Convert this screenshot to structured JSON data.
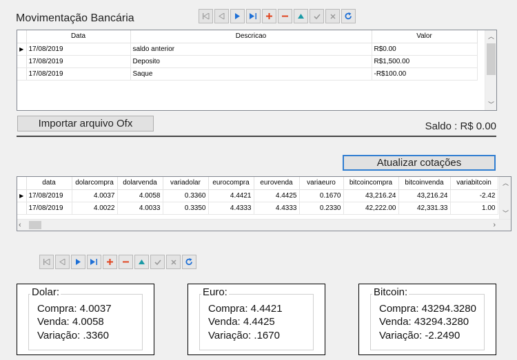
{
  "window": {
    "title": "Movimentação Bancária"
  },
  "mov_grid": {
    "columns": [
      "Data",
      "Descricao",
      "Valor"
    ],
    "rows": [
      {
        "data": "17/08/2019",
        "descricao": "saldo anterior",
        "valor": "R$0.00"
      },
      {
        "data": "17/08/2019",
        "descricao": "Deposito",
        "valor": "R$1,500.00"
      },
      {
        "data": "17/08/2019",
        "descricao": "Saque",
        "valor": "-R$100.00"
      }
    ]
  },
  "import_button": {
    "label": "Importar arquivo Ofx"
  },
  "saldo": {
    "text": "Saldo : R$ 0.00"
  },
  "update_button": {
    "label": "Atualizar cotações"
  },
  "cot_grid": {
    "columns": [
      "data",
      "dolarcompra",
      "dolarvenda",
      "variadolar",
      "eurocompra",
      "eurovenda",
      "variaeuro",
      "bitcoincompra",
      "bitcoinvenda",
      "variabitcoin"
    ],
    "rows": [
      [
        "17/08/2019",
        "4.0037",
        "4.0058",
        "0.3360",
        "4.4421",
        "4.4425",
        "0.1670",
        "43,216.24",
        "43,216.24",
        "-2.42"
      ],
      [
        "17/08/2019",
        "4.0022",
        "4.0033",
        "0.3350",
        "4.4333",
        "4.4333",
        "0.2330",
        "42,222.00",
        "42,331.33",
        "1.00"
      ]
    ]
  },
  "dolar": {
    "legend": "Dolar:",
    "compra": "Compra: 4.0037",
    "venda": "Venda: 4.0058",
    "variacao": "Variação: .3360"
  },
  "euro": {
    "legend": "Euro:",
    "compra": "Compra: 4.4421",
    "venda": "Venda: 4.4425",
    "variacao": "Variação: .1670"
  },
  "bitcoin": {
    "legend": "Bitcoin:",
    "compra": "Compra: 43294.3280",
    "venda": "Venda: 43294.3280",
    "variacao": "Variação: -2.2490"
  },
  "navigator_icons": [
    "first-icon",
    "prior-icon",
    "next-icon",
    "last-icon",
    "insert-icon",
    "delete-icon",
    "edit-icon",
    "post-icon",
    "cancel-icon",
    "refresh-icon"
  ],
  "colors": {
    "nav_blue": "#1d6fd6",
    "nav_red": "#e0431d",
    "nav_teal": "#1a9aa6",
    "focus_border": "#2f7dd1"
  }
}
